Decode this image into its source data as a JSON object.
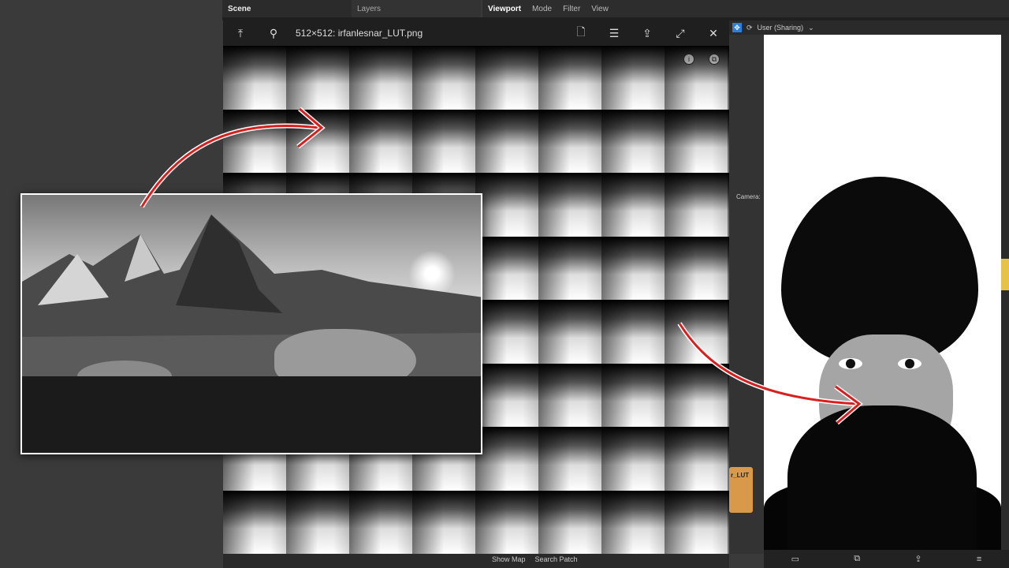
{
  "scene_panel": {
    "tabs": [
      "Scene",
      "Layers"
    ]
  },
  "viewport_panel": {
    "tabs": [
      "Viewport",
      "Mode",
      "Filter",
      "View"
    ]
  },
  "image_viewer": {
    "title": "512×512: irfanlesnar_LUT.png",
    "toolbar_icons": [
      "upload-icon",
      "pin-icon",
      "new-file-icon",
      "list-icon",
      "share-icon",
      "expand-icon",
      "close-icon"
    ],
    "overlay_icons": [
      "info-icon",
      "copy-icon"
    ]
  },
  "preview": {
    "user_label": "User (Sharing)",
    "camera_label": "Camera:",
    "bottom_icons": [
      "video-icon",
      "screenshot-icon",
      "share-icon",
      "menu-icon"
    ]
  },
  "node": {
    "label": "r_LUT"
  },
  "patch_bar": {
    "items": [
      "Show Map",
      "Search Patch"
    ]
  },
  "colors": {
    "arrow": "#d81f1f",
    "accent": "#2a7fe0",
    "node": "#d89a4a"
  }
}
